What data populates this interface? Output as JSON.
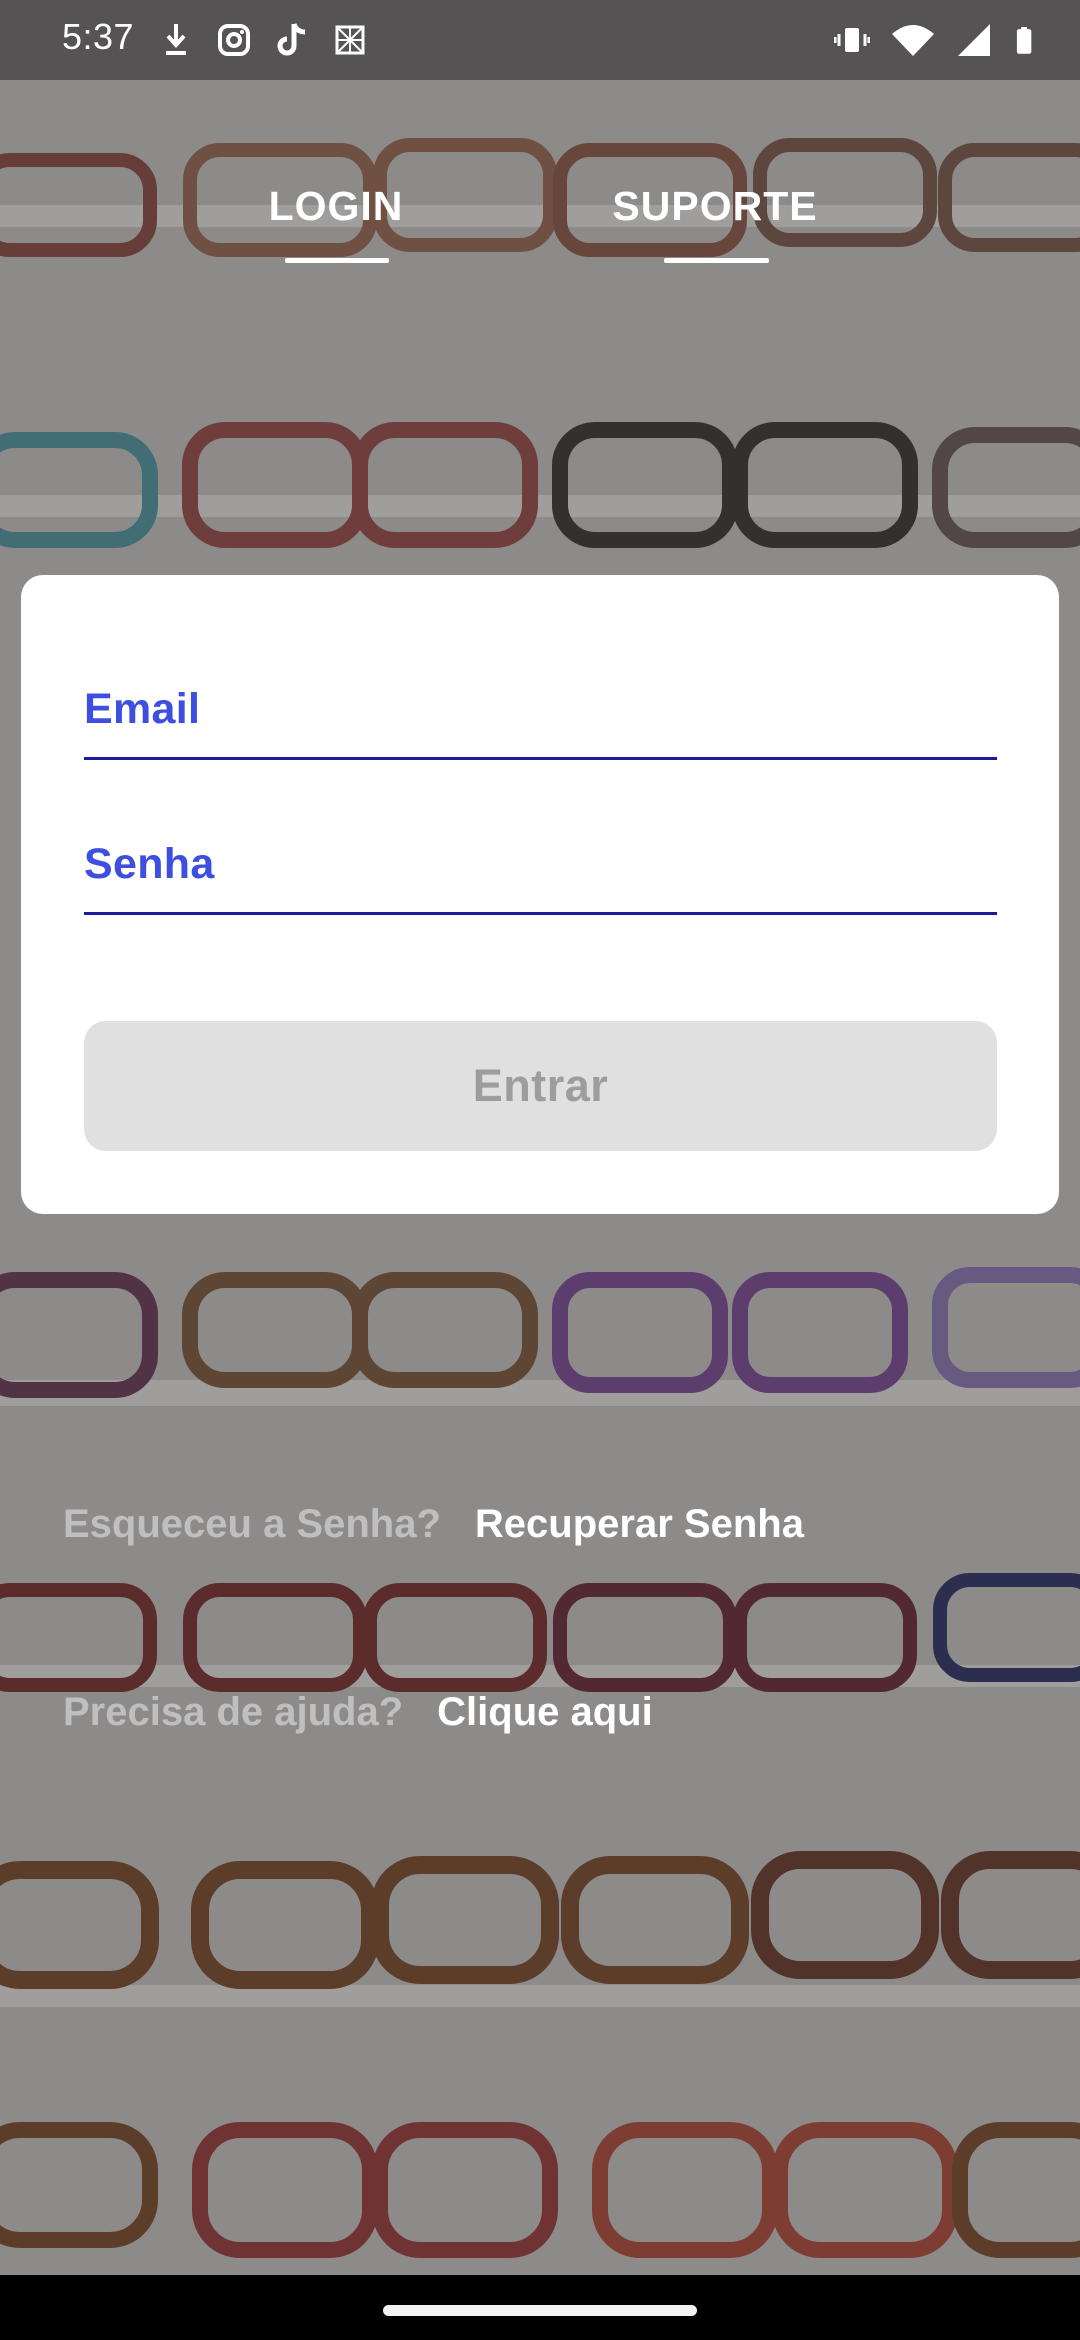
{
  "status_bar": {
    "time": "5:37",
    "left_icons": [
      "download-icon",
      "instagram-icon",
      "tiktok-icon",
      "app-icon"
    ],
    "right_icons": [
      "vibrate-icon",
      "wifi-icon",
      "signal-icon",
      "battery-icon"
    ]
  },
  "tabs": [
    {
      "label": "LOGIN",
      "active": true
    },
    {
      "label": "SUPORTE",
      "active": false
    }
  ],
  "login_form": {
    "email_label": "Email",
    "password_label": "Senha",
    "submit_label": "Entrar"
  },
  "forgot_password": {
    "prompt": "Esqueceu a Senha?",
    "link": "Recuperar Senha"
  },
  "help": {
    "prompt": "Precisa de ajuda?",
    "link": "Clique aqui"
  },
  "colors": {
    "accent": "#3d4ee0",
    "field_underline": "#1c1b9a",
    "button_disabled_bg": "#e0e0e0",
    "button_disabled_text": "#9d9d9d"
  }
}
